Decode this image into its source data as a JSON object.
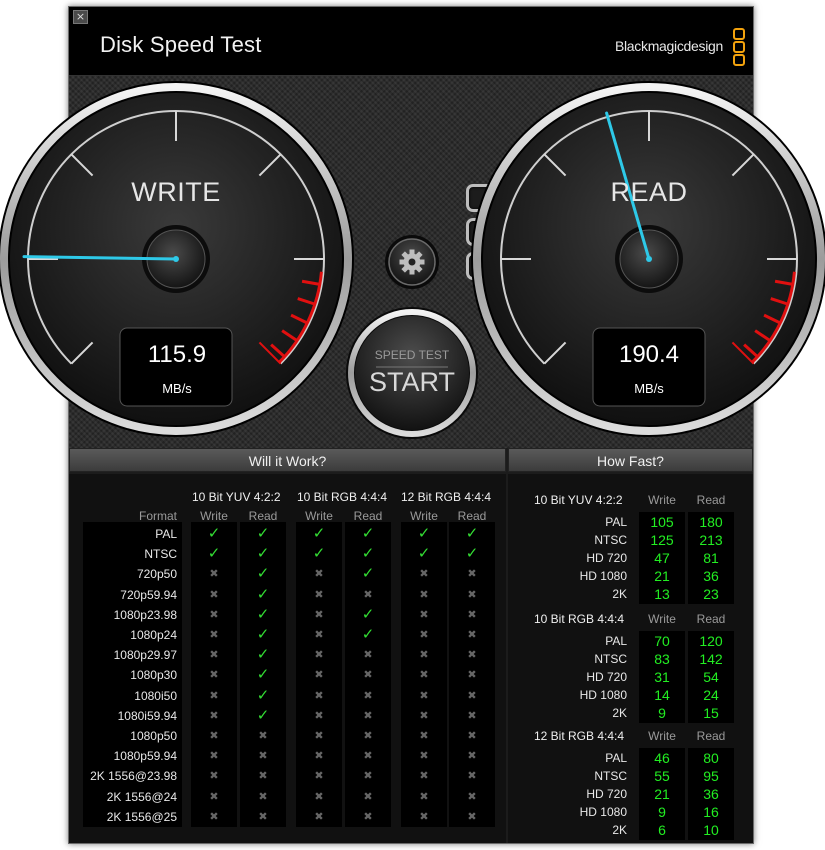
{
  "window": {
    "title": "Disk Speed Test",
    "brand": "Blackmagicdesign",
    "close_icon": "×"
  },
  "gauges": {
    "write": {
      "label": "WRITE",
      "value": "115.9",
      "unit": "MB/s",
      "needle_fraction": 0.17
    },
    "read": {
      "label": "READ",
      "value": "190.4",
      "unit": "MB/s",
      "needle_fraction": 0.44
    }
  },
  "start_button": {
    "caption": "SPEED TEST",
    "label": "START"
  },
  "will_it_work": {
    "title": "Will it Work?",
    "format_header": "Format",
    "groups": [
      "10 Bit YUV 4:2:2",
      "10 Bit RGB 4:4:4",
      "12 Bit RGB 4:4:4"
    ],
    "col_write": "Write",
    "col_read": "Read",
    "rows": [
      {
        "format": "PAL",
        "checks": [
          1,
          1,
          1,
          1,
          1,
          1
        ]
      },
      {
        "format": "NTSC",
        "checks": [
          1,
          1,
          1,
          1,
          1,
          1
        ]
      },
      {
        "format": "720p50",
        "checks": [
          0,
          1,
          0,
          1,
          0,
          0
        ]
      },
      {
        "format": "720p59.94",
        "checks": [
          0,
          1,
          0,
          0,
          0,
          0
        ]
      },
      {
        "format": "1080p23.98",
        "checks": [
          0,
          1,
          0,
          1,
          0,
          0
        ]
      },
      {
        "format": "1080p24",
        "checks": [
          0,
          1,
          0,
          1,
          0,
          0
        ]
      },
      {
        "format": "1080p29.97",
        "checks": [
          0,
          1,
          0,
          0,
          0,
          0
        ]
      },
      {
        "format": "1080p30",
        "checks": [
          0,
          1,
          0,
          0,
          0,
          0
        ]
      },
      {
        "format": "1080i50",
        "checks": [
          0,
          1,
          0,
          0,
          0,
          0
        ]
      },
      {
        "format": "1080i59.94",
        "checks": [
          0,
          1,
          0,
          0,
          0,
          0
        ]
      },
      {
        "format": "1080p50",
        "checks": [
          0,
          0,
          0,
          0,
          0,
          0
        ]
      },
      {
        "format": "1080p59.94",
        "checks": [
          0,
          0,
          0,
          0,
          0,
          0
        ]
      },
      {
        "format": "2K 1556@23.98",
        "checks": [
          0,
          0,
          0,
          0,
          0,
          0
        ]
      },
      {
        "format": "2K 1556@24",
        "checks": [
          0,
          0,
          0,
          0,
          0,
          0
        ]
      },
      {
        "format": "2K 1556@25",
        "checks": [
          0,
          0,
          0,
          0,
          0,
          0
        ]
      }
    ]
  },
  "how_fast": {
    "title": "How Fast?",
    "col_write": "Write",
    "col_read": "Read",
    "groups": [
      {
        "name": "10 Bit YUV 4:2:2",
        "rows": [
          {
            "format": "PAL",
            "write": "105",
            "read": "180"
          },
          {
            "format": "NTSC",
            "write": "125",
            "read": "213"
          },
          {
            "format": "HD 720",
            "write": "47",
            "read": "81"
          },
          {
            "format": "HD 1080",
            "write": "21",
            "read": "36"
          },
          {
            "format": "2K",
            "write": "13",
            "read": "23"
          }
        ]
      },
      {
        "name": "10 Bit RGB 4:4:4",
        "rows": [
          {
            "format": "PAL",
            "write": "70",
            "read": "120"
          },
          {
            "format": "NTSC",
            "write": "83",
            "read": "142"
          },
          {
            "format": "HD 720",
            "write": "31",
            "read": "54"
          },
          {
            "format": "HD 1080",
            "write": "14",
            "read": "24"
          },
          {
            "format": "2K",
            "write": "9",
            "read": "15"
          }
        ]
      },
      {
        "name": "12 Bit RGB 4:4:4",
        "rows": [
          {
            "format": "PAL",
            "write": "46",
            "read": "80"
          },
          {
            "format": "NTSC",
            "write": "55",
            "read": "95"
          },
          {
            "format": "HD 720",
            "write": "21",
            "read": "36"
          },
          {
            "format": "HD 1080",
            "write": "9",
            "read": "16"
          },
          {
            "format": "2K",
            "write": "6",
            "read": "10"
          }
        ]
      }
    ]
  },
  "colors": {
    "needle": "#2ec9e8",
    "redzone": "#e01010",
    "check": "#33dd33",
    "speed": "#22ee22"
  }
}
